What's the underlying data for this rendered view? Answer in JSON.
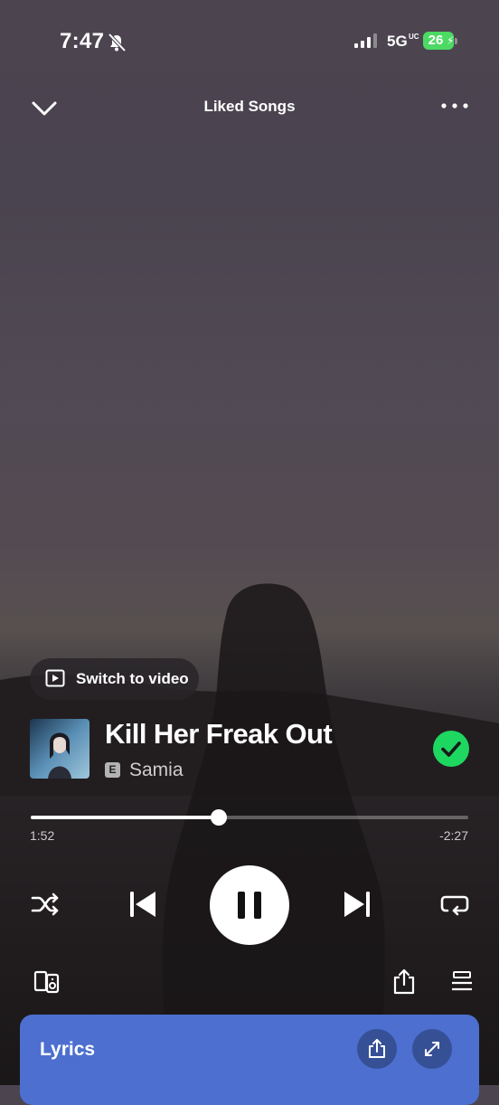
{
  "status_bar": {
    "time": "7:47",
    "network": "5G",
    "network_sub": "UC",
    "battery": "26"
  },
  "header": {
    "title": "Liked Songs"
  },
  "video_toggle": {
    "label": "Switch to video"
  },
  "track": {
    "title": "Kill Her Freak Out",
    "explicit_label": "E",
    "artist": "Samia",
    "liked": true
  },
  "progress": {
    "elapsed": "1:52",
    "remaining": "-2:27",
    "fraction": 0.43
  },
  "controls": {
    "shuffle_icon": "shuffle-icon",
    "previous_icon": "skip-previous-icon",
    "play_state": "playing",
    "next_icon": "skip-next-icon",
    "repeat_icon": "repeat-icon"
  },
  "lyrics": {
    "label": "Lyrics"
  },
  "colors": {
    "accent_green": "#1ed760",
    "lyrics_card": "#4c6fd0",
    "battery_green": "#4cd964"
  }
}
